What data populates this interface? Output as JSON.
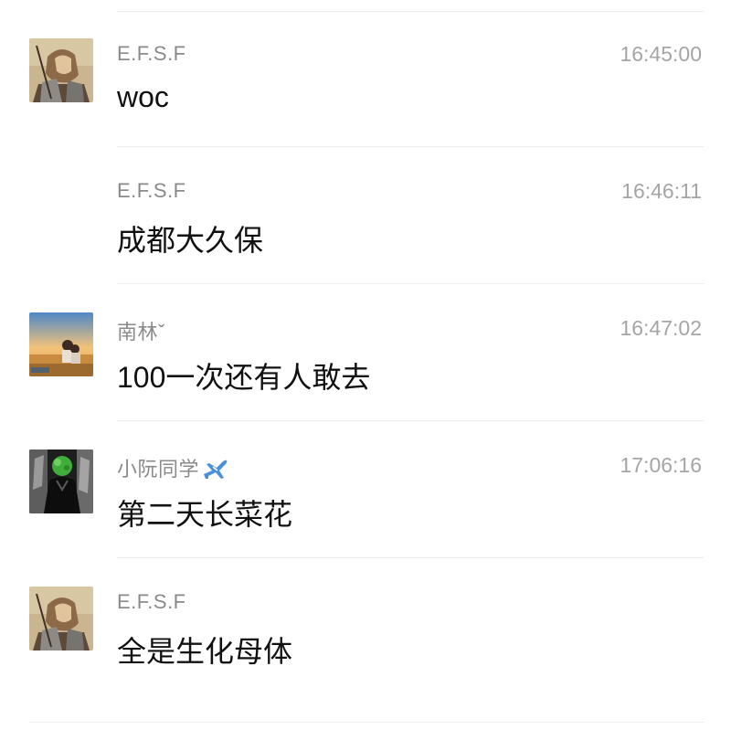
{
  "messages": [
    {
      "sender": "E.F.S.F",
      "time": "16:45:00",
      "text": "woc",
      "avatar": "manga-warrior-avatar"
    },
    {
      "sender": "E.F.S.F",
      "time": "16:46:11",
      "text": "成都大久保",
      "avatar": ""
    },
    {
      "sender": "南林ˇ",
      "time": "16:47:02",
      "text": "100一次还有人敢去",
      "avatar": "sunset-field-avatar"
    },
    {
      "sender": "小阮同学",
      "sender_emoji": "airplane-icon",
      "time": "17:06:16",
      "text": "第二天长菜花",
      "avatar": "green-head-avatar"
    },
    {
      "sender": "E.F.S.F",
      "time": "",
      "text": "全是生化母体",
      "avatar": "manga-warrior-avatar"
    }
  ],
  "colors": {
    "sender": "#8a8a8a",
    "time": "#a5a5a5",
    "text": "#111111",
    "divider": "#ececec",
    "background": "#ffffff",
    "plane": "#4a90d9"
  }
}
